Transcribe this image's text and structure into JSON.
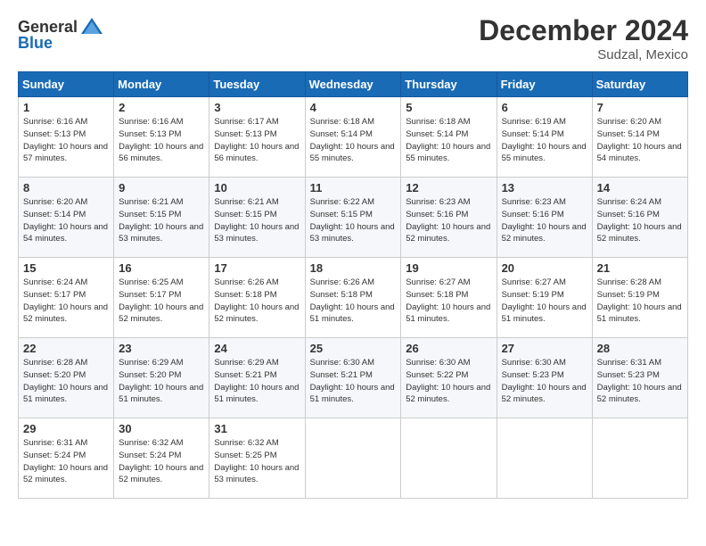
{
  "logo": {
    "general": "General",
    "blue": "Blue"
  },
  "title": "December 2024",
  "subtitle": "Sudzal, Mexico",
  "days_of_week": [
    "Sunday",
    "Monday",
    "Tuesday",
    "Wednesday",
    "Thursday",
    "Friday",
    "Saturday"
  ],
  "weeks": [
    [
      {
        "day": "1",
        "sunrise": "6:16 AM",
        "sunset": "5:13 PM",
        "daylight": "10 hours and 57 minutes."
      },
      {
        "day": "2",
        "sunrise": "6:16 AM",
        "sunset": "5:13 PM",
        "daylight": "10 hours and 56 minutes."
      },
      {
        "day": "3",
        "sunrise": "6:17 AM",
        "sunset": "5:13 PM",
        "daylight": "10 hours and 56 minutes."
      },
      {
        "day": "4",
        "sunrise": "6:18 AM",
        "sunset": "5:14 PM",
        "daylight": "10 hours and 55 minutes."
      },
      {
        "day": "5",
        "sunrise": "6:18 AM",
        "sunset": "5:14 PM",
        "daylight": "10 hours and 55 minutes."
      },
      {
        "day": "6",
        "sunrise": "6:19 AM",
        "sunset": "5:14 PM",
        "daylight": "10 hours and 55 minutes."
      },
      {
        "day": "7",
        "sunrise": "6:20 AM",
        "sunset": "5:14 PM",
        "daylight": "10 hours and 54 minutes."
      }
    ],
    [
      {
        "day": "8",
        "sunrise": "6:20 AM",
        "sunset": "5:14 PM",
        "daylight": "10 hours and 54 minutes."
      },
      {
        "day": "9",
        "sunrise": "6:21 AM",
        "sunset": "5:15 PM",
        "daylight": "10 hours and 53 minutes."
      },
      {
        "day": "10",
        "sunrise": "6:21 AM",
        "sunset": "5:15 PM",
        "daylight": "10 hours and 53 minutes."
      },
      {
        "day": "11",
        "sunrise": "6:22 AM",
        "sunset": "5:15 PM",
        "daylight": "10 hours and 53 minutes."
      },
      {
        "day": "12",
        "sunrise": "6:23 AM",
        "sunset": "5:16 PM",
        "daylight": "10 hours and 52 minutes."
      },
      {
        "day": "13",
        "sunrise": "6:23 AM",
        "sunset": "5:16 PM",
        "daylight": "10 hours and 52 minutes."
      },
      {
        "day": "14",
        "sunrise": "6:24 AM",
        "sunset": "5:16 PM",
        "daylight": "10 hours and 52 minutes."
      }
    ],
    [
      {
        "day": "15",
        "sunrise": "6:24 AM",
        "sunset": "5:17 PM",
        "daylight": "10 hours and 52 minutes."
      },
      {
        "day": "16",
        "sunrise": "6:25 AM",
        "sunset": "5:17 PM",
        "daylight": "10 hours and 52 minutes."
      },
      {
        "day": "17",
        "sunrise": "6:26 AM",
        "sunset": "5:18 PM",
        "daylight": "10 hours and 52 minutes."
      },
      {
        "day": "18",
        "sunrise": "6:26 AM",
        "sunset": "5:18 PM",
        "daylight": "10 hours and 51 minutes."
      },
      {
        "day": "19",
        "sunrise": "6:27 AM",
        "sunset": "5:18 PM",
        "daylight": "10 hours and 51 minutes."
      },
      {
        "day": "20",
        "sunrise": "6:27 AM",
        "sunset": "5:19 PM",
        "daylight": "10 hours and 51 minutes."
      },
      {
        "day": "21",
        "sunrise": "6:28 AM",
        "sunset": "5:19 PM",
        "daylight": "10 hours and 51 minutes."
      }
    ],
    [
      {
        "day": "22",
        "sunrise": "6:28 AM",
        "sunset": "5:20 PM",
        "daylight": "10 hours and 51 minutes."
      },
      {
        "day": "23",
        "sunrise": "6:29 AM",
        "sunset": "5:20 PM",
        "daylight": "10 hours and 51 minutes."
      },
      {
        "day": "24",
        "sunrise": "6:29 AM",
        "sunset": "5:21 PM",
        "daylight": "10 hours and 51 minutes."
      },
      {
        "day": "25",
        "sunrise": "6:30 AM",
        "sunset": "5:21 PM",
        "daylight": "10 hours and 51 minutes."
      },
      {
        "day": "26",
        "sunrise": "6:30 AM",
        "sunset": "5:22 PM",
        "daylight": "10 hours and 52 minutes."
      },
      {
        "day": "27",
        "sunrise": "6:30 AM",
        "sunset": "5:23 PM",
        "daylight": "10 hours and 52 minutes."
      },
      {
        "day": "28",
        "sunrise": "6:31 AM",
        "sunset": "5:23 PM",
        "daylight": "10 hours and 52 minutes."
      }
    ],
    [
      {
        "day": "29",
        "sunrise": "6:31 AM",
        "sunset": "5:24 PM",
        "daylight": "10 hours and 52 minutes."
      },
      {
        "day": "30",
        "sunrise": "6:32 AM",
        "sunset": "5:24 PM",
        "daylight": "10 hours and 52 minutes."
      },
      {
        "day": "31",
        "sunrise": "6:32 AM",
        "sunset": "5:25 PM",
        "daylight": "10 hours and 53 minutes."
      },
      null,
      null,
      null,
      null
    ]
  ],
  "labels": {
    "sunrise": "Sunrise:",
    "sunset": "Sunset:",
    "daylight": "Daylight:"
  }
}
